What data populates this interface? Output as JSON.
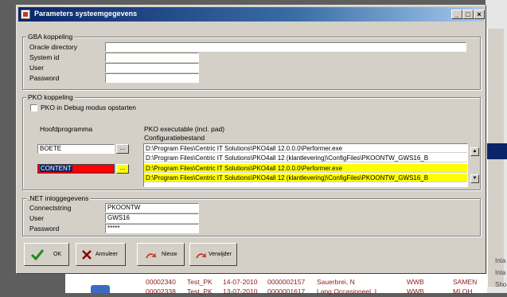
{
  "dialog": {
    "title": "Parameters systeemgegevens",
    "controls": {
      "minimize": "_",
      "maximize": "□",
      "close": "×"
    }
  },
  "gba": {
    "group_label": "GBA koppeling",
    "oracle_label": "Oracle directory",
    "oracle_value": "",
    "system_label": "System id",
    "system_value": "",
    "user_label": "User",
    "user_value": "",
    "password_label": "Password",
    "password_value": ""
  },
  "pko": {
    "group_label": "PKO koppeling",
    "debug_label": "PKO in Debug modus opstarten",
    "debug_checked": false,
    "hoofd_header": "Hoofdprogramma",
    "exe_header": "PKO executable (incl. pad)",
    "config_header": "Configuratiebestand",
    "rows": [
      {
        "name": "BOETE",
        "dots": "...",
        "exe": "D:\\Program Files\\Centric IT Solutions\\PKO4all 12.0.0.0\\Performer.exe",
        "config": "D:\\Program Files\\Centric IT Solutions\\PKO4all 12 (klantlevering)\\ConfigFiles\\PKOONTW_GWS16_B"
      },
      {
        "name": "CONTENT",
        "dots": "...",
        "exe": "D:\\Program Files\\Centric IT Solutions\\PKO4all 12.0.0.0\\Performer.exe",
        "config": "D:\\Program Files\\Centric IT Solutions\\PKO4all 12 (klantlevering)\\ConfigFiles\\PKOONTW_GWS16_B"
      }
    ],
    "scroll_up": "▲",
    "scroll_down": "▼"
  },
  "net": {
    "group_label": ".NET inloggegevens",
    "connect_label": "Connectstring",
    "connect_value": "PKOONTW",
    "user_label": "User",
    "user_value": "GWS16",
    "password_label": "Password",
    "password_value": "*****"
  },
  "buttons": {
    "ok": "OK",
    "annuleer": "Annuleer",
    "nieuw": "Nieuw",
    "verwijder": "Verwijder"
  },
  "background": {
    "rows": [
      {
        "id": "00002340",
        "name": "Test_PK",
        "date": "14-07-2010",
        "num": "0000002157",
        "person": "Sauerbrei, N",
        "code": "WWB",
        "status": "SAMEN",
        "extra": "Inta"
      },
      {
        "id": "00002338",
        "name": "Test_PK",
        "date": "13-07-2010",
        "num": "0000001617",
        "person": "Lang Occasioneel, I",
        "code": "WWB",
        "status": "MLOH",
        "extra": "Sho"
      }
    ],
    "side_text": [
      "Inta",
      "Inta",
      "Sho"
    ]
  },
  "colors": {
    "title_gradient_start": "#0a246a",
    "title_gradient_end": "#a6caf0",
    "highlight_yellow": "#ffff00",
    "error_red": "#ff0000",
    "selection_blue": "#0a246a",
    "ok_check_green": "#1f8b1f"
  },
  "icons": {
    "ok": "green-check-icon",
    "annuleer": "red-x-icon",
    "nieuw": "red-arrow-icon",
    "verwijder": "red-arrow-icon"
  }
}
